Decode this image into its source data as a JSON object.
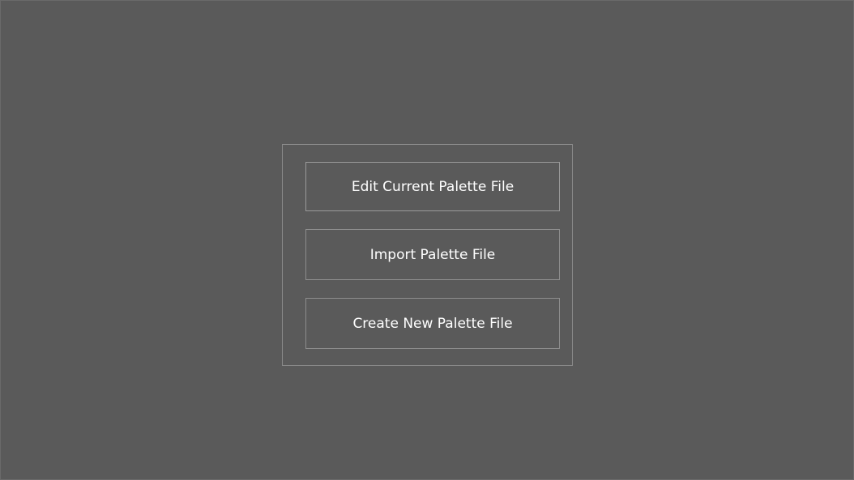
{
  "dialog": {
    "buttons": [
      {
        "label": "Edit Current Palette File"
      },
      {
        "label": "Import Palette File"
      },
      {
        "label": "Create New Palette File"
      }
    ]
  },
  "colors": {
    "background": "#5a5a5a",
    "border": "#8e8e8e",
    "text": "#ffffff"
  }
}
